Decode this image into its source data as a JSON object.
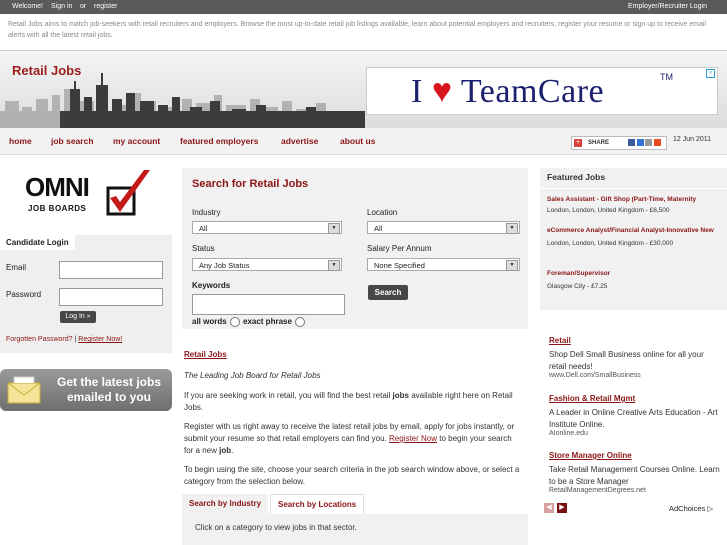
{
  "topbar": {
    "welcome": "Welcome!",
    "signin": "Sign in",
    "or": "or",
    "register": "register",
    "employer_login": "Employer/Recruiter Login"
  },
  "intro": "Retail Jobs aims to match job-seekers with retail recruiters and employers. Browse the most up-to-date retail job listings available, learn about potential employers and recruiters, register your resume or sign up to receive email alerts with all the latest retail jobs.",
  "header": {
    "site_title": "Retail Jobs",
    "ad": {
      "i": "I",
      "heart": "♥",
      "brand": "TeamCare",
      "tm": "TM",
      "close": "x"
    }
  },
  "nav": {
    "items": [
      "home",
      "job search",
      "my account",
      "featured employers",
      "advertise",
      "about us"
    ],
    "share": "SHARE",
    "date": "12 Jun 2011"
  },
  "logo": {
    "name": "OMNI",
    "sub": "JOB BOARDS"
  },
  "login": {
    "title": "Candidate Login",
    "email_label": "Email",
    "password_label": "Password",
    "button": "Log In »",
    "forgot": "Forgotten Password?",
    "sep": "|",
    "register": "Register Now!"
  },
  "email_banner": "Get the latest jobs emailed to you",
  "search": {
    "title": "Search for Retail Jobs",
    "industry_label": "Industry",
    "industry_value": "All",
    "location_label": "Location",
    "location_value": "All",
    "status_label": "Status",
    "status_value": "Any Job Status",
    "salary_label": "Salary Per Annum",
    "salary_value": "None Specified",
    "keywords_label": "Keywords",
    "all_words": "all words",
    "exact_phrase": "exact phrase",
    "button": "Search"
  },
  "main": {
    "heading": "Retail Jobs",
    "tagline": "The Leading Job Board for Retail Jobs",
    "p1_pre": "If you are seeking work in retail, you will find the best retail ",
    "p1_bold": "jobs",
    "p1_post": " available right here on Retail Jobs.",
    "p2_pre": "Register with us right away to receive the latest retail jobs by email, apply for jobs instantly, or submit your resume so that retail employers can find you. ",
    "p2_link": "Register Now",
    "p2_mid": " to begin your search for a new ",
    "p2_bold": "job",
    "p2_end": ".",
    "p3": "To begin using the site, choose your search criteria in the job search window above, or select a category from the selection below.",
    "tabs": [
      "Search by Industry",
      "Search by Locations"
    ],
    "tab_hint": "Click on a category to view jobs in that sector."
  },
  "featured": {
    "title": "Featured Jobs",
    "jobs": [
      {
        "title": "Sales Assistant - Gift Shop (Part-Time, Maternity",
        "loc": "London, London, United Kingdom - £8,500"
      },
      {
        "title": "eCommerce Analyst/Financial Analyst-Innovative New",
        "loc": "London, London, United Kingdom - £30,000"
      },
      {
        "title": "Foreman/Supervisor",
        "loc": "Glasgow City - £7.25"
      }
    ]
  },
  "ads": [
    {
      "title": "Retail",
      "body": "Shop Dell Small Business online for all your retail needs!",
      "url": "www.Dell.com/SmallBusiness"
    },
    {
      "title": "Fashion & Retail Mgmt",
      "body": "A Leader in Online Creative Arts Education - Art Institute Online.",
      "url": "AIonline.edu"
    },
    {
      "title": "Store Manager Online",
      "body": "Take Retail Management Courses Online. Learn to be a Store Manager",
      "url": "RetailManagementDegrees.net"
    }
  ],
  "adchoices": "AdChoices ▷",
  "colors": {
    "brand": "#8b1414",
    "dark": "#474747",
    "panel": "#f1f1f1"
  }
}
